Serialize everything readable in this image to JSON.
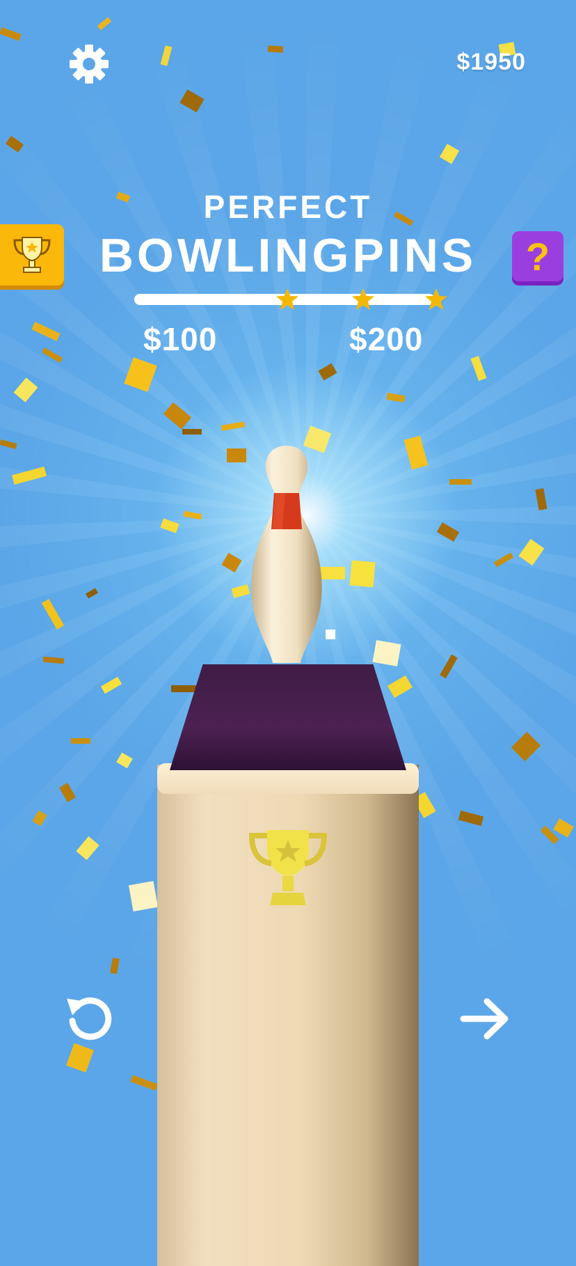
{
  "header": {
    "balance": "$1950",
    "settings_icon": "gear-icon"
  },
  "result": {
    "subtitle": "PERFECT",
    "title": "BOWLINGPINS"
  },
  "side_buttons": {
    "trophy_icon": "trophy-icon",
    "mystery_label": "?"
  },
  "progress": {
    "stars": 3,
    "reward_1": "$100",
    "reward_2": "$200"
  },
  "footer": {
    "restart_icon": "restart-icon",
    "next_icon": "arrow-right-icon"
  },
  "colors": {
    "background": "#5ba6e8",
    "accent_gold": "#f9b80a",
    "mystery_purple": "#9b3ee0",
    "star_gold": "#f5b800"
  }
}
